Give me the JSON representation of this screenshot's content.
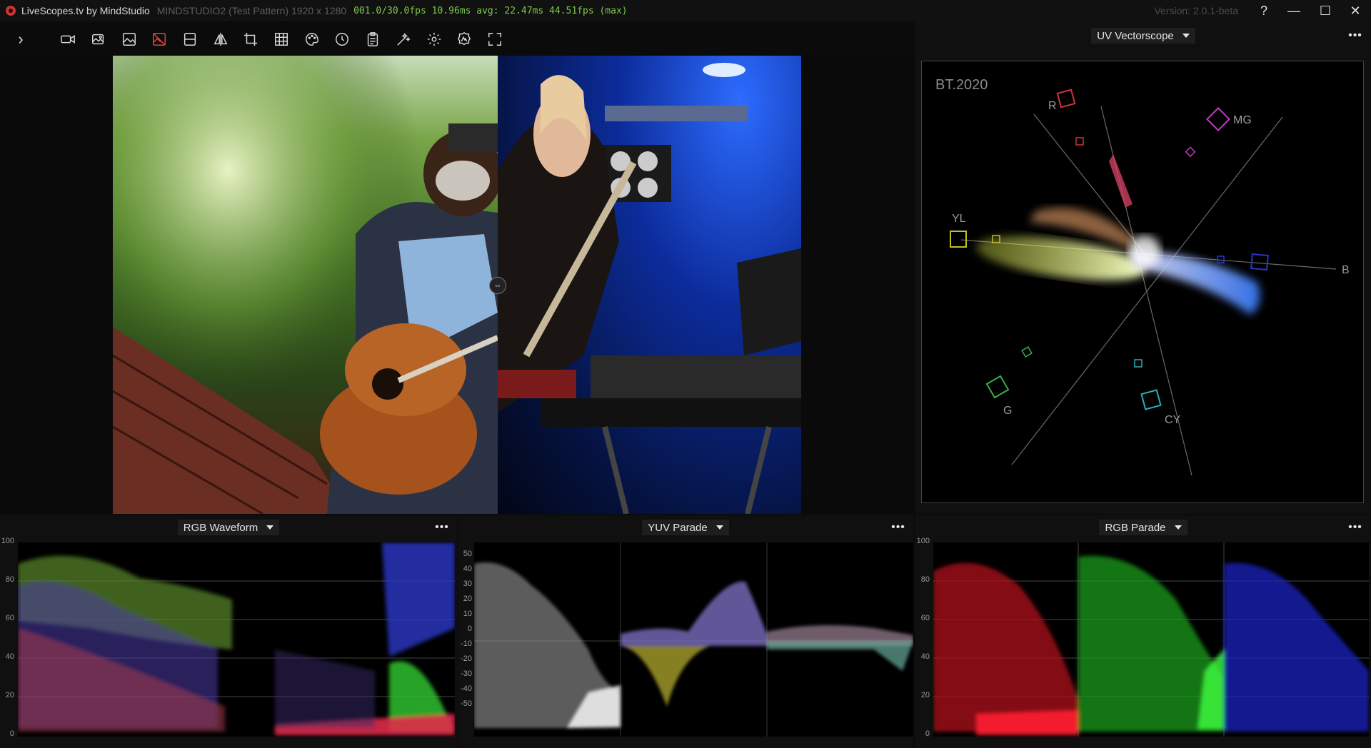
{
  "titlebar": {
    "app_title": "LiveScopes.tv by MindStudio",
    "source": "MINDSTUDIO2 (Test Pattern) 1920 x 1280",
    "fps": "001.0/30.0fps 10.96ms avg: 22.47ms 44.51fps (max)",
    "version": "Version: 2.0.1-beta",
    "help": "?",
    "minimize": "—",
    "maximize": "☐",
    "close": "✕"
  },
  "toolbar": {
    "expand": "›",
    "items": [
      "video-camera-icon",
      "image-gallery-icon",
      "image-icon",
      "image-off-icon",
      "split-horizontal-icon",
      "mirror-icon",
      "crop-icon",
      "grid-icon",
      "palette-icon",
      "clock-icon",
      "clipboard-icon",
      "magic-wand-icon",
      "gear-icon",
      "badge-icon",
      "fullscreen-icon"
    ],
    "active_item": "image-off-icon",
    "active_color": "#e0443a"
  },
  "viewer": {
    "split_handle": "⇔"
  },
  "vectorscope": {
    "selector": "UV Vectorscope",
    "more": "•••",
    "standard_label": "BT.2020",
    "targets": [
      "R",
      "MG",
      "YL",
      "B",
      "G",
      "CY"
    ],
    "colors": {
      "R": "#d0343c",
      "MG": "#c23ac0",
      "YL": "#c4be2a",
      "B": "#2a37c4",
      "G": "#32b446",
      "CY": "#2ab0b4"
    }
  },
  "rgb_waveform": {
    "selector": "RGB Waveform",
    "more": "•••",
    "scale": [
      "100",
      "80",
      "60",
      "40",
      "20",
      "0"
    ]
  },
  "yuv_parade": {
    "selector": "YUV Parade",
    "more": "•••",
    "scale": [
      "50",
      "40",
      "30",
      "20",
      "10",
      "0",
      "-10",
      "-20",
      "-30",
      "-40",
      "-50"
    ]
  },
  "rgb_parade": {
    "selector": "RGB Parade",
    "more": "•••",
    "scale": [
      "100",
      "80",
      "60",
      "40",
      "20",
      "0"
    ]
  }
}
